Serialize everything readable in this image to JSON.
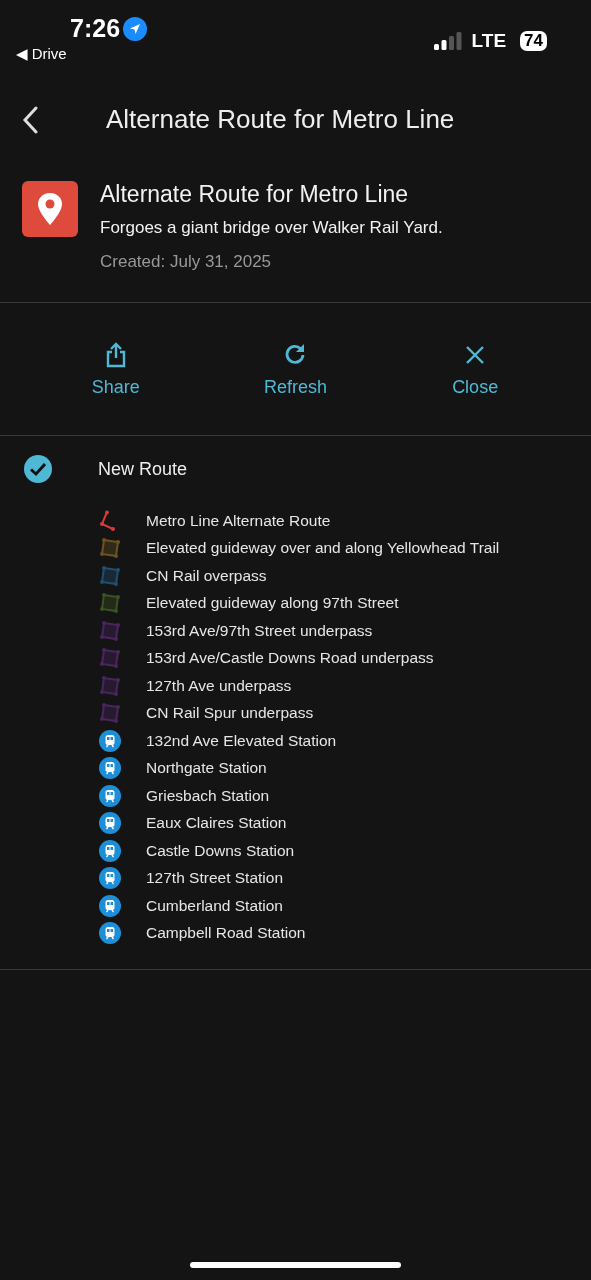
{
  "status_bar": {
    "time": "7:26",
    "back_app": "◀ Drive",
    "network": "LTE",
    "battery": "74"
  },
  "header": {
    "title": "Alternate Route for Metro Line"
  },
  "map_info": {
    "title": "Alternate Route for Metro Line",
    "description": "Forgoes a giant bridge over Walker Rail Yard.",
    "created": "Created: July 31, 2025"
  },
  "actions": [
    {
      "kind": "share",
      "label": "Share"
    },
    {
      "kind": "refresh",
      "label": "Refresh"
    },
    {
      "kind": "close",
      "label": "Close"
    }
  ],
  "layer": {
    "name": "New Route",
    "checked": true,
    "items": [
      {
        "kind": "line",
        "label": "Metro Line Alternate Route",
        "color": "#d63b3b"
      },
      {
        "kind": "polygon",
        "label": "Elevated guideway over and along Yellowhead Trail",
        "color": "#6b5220"
      },
      {
        "kind": "polygon",
        "label": "CN Rail overpass",
        "color": "#1f4f73"
      },
      {
        "kind": "polygon",
        "label": "Elevated guideway along 97th Street",
        "color": "#3c5223"
      },
      {
        "kind": "polygon",
        "label": "153rd Ave/97th Street underpass",
        "color": "#4a2560"
      },
      {
        "kind": "polygon",
        "label": "153rd Ave/Castle Downs Road underpass",
        "color": "#4a2560"
      },
      {
        "kind": "polygon",
        "label": "127th Ave underpass",
        "color": "#4a2560"
      },
      {
        "kind": "polygon",
        "label": "CN Rail Spur underpass",
        "color": "#4a2560"
      },
      {
        "kind": "station",
        "label": "132nd Ave Elevated Station"
      },
      {
        "kind": "station",
        "label": "Northgate Station"
      },
      {
        "kind": "station",
        "label": "Griesbach Station"
      },
      {
        "kind": "station",
        "label": "Eaux Claires Station"
      },
      {
        "kind": "station",
        "label": "Castle Downs Station"
      },
      {
        "kind": "station",
        "label": "127th Street Station"
      },
      {
        "kind": "station",
        "label": "Cumberland Station"
      },
      {
        "kind": "station",
        "label": "Campbell Road Station"
      }
    ]
  }
}
